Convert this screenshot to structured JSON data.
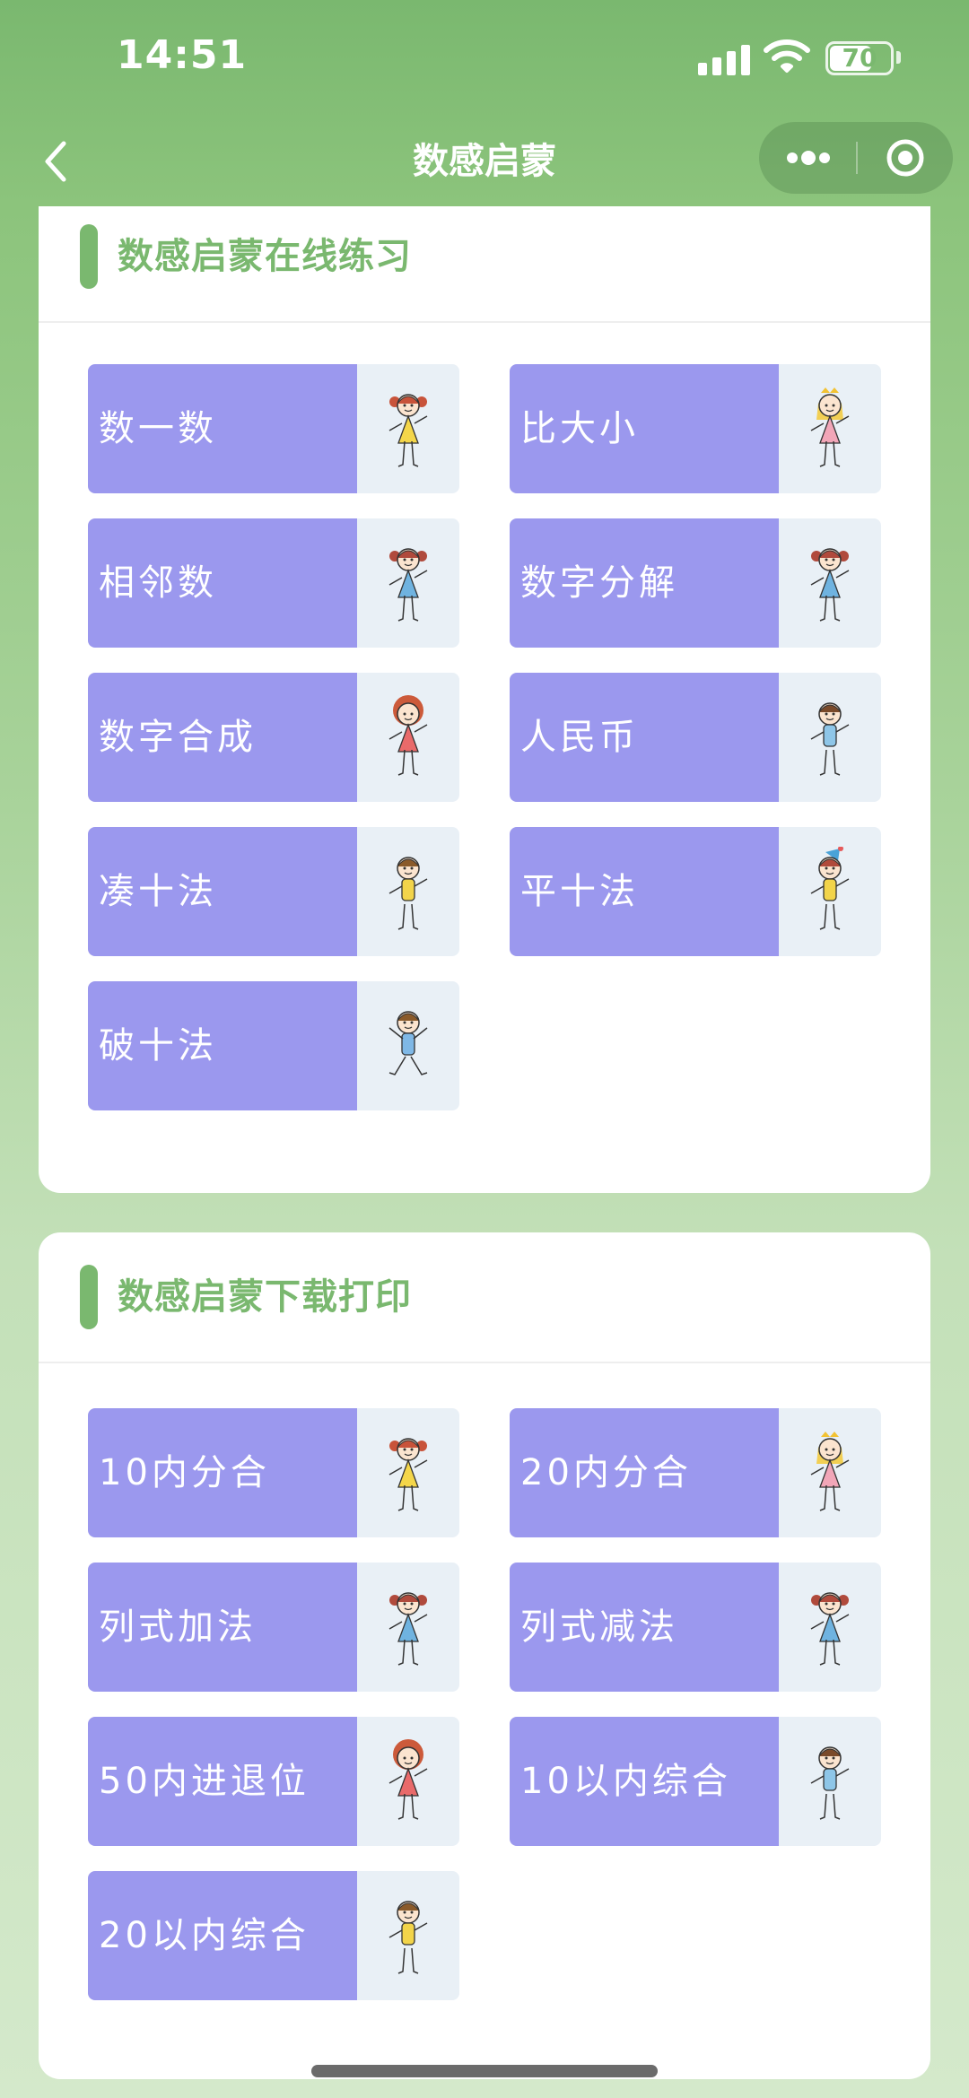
{
  "status_bar": {
    "time": "14:51",
    "battery": "70",
    "battery_level": 0.7
  },
  "nav": {
    "title": "数感启蒙"
  },
  "colors": {
    "accent_green": "#7ab86f",
    "tile_purple": "#9b98ee",
    "tile_art_bg": "#e9f0f6"
  },
  "sections": [
    {
      "title": "数感启蒙在线练习",
      "items": [
        {
          "label": "数一数",
          "icon": "girl-pigtails-yellow-dress-icon"
        },
        {
          "label": "比大小",
          "icon": "princess-pink-dress-icon"
        },
        {
          "label": "相邻数",
          "icon": "girl-blue-dress-icon"
        },
        {
          "label": "数字分解",
          "icon": "girl-blue-dress-icon"
        },
        {
          "label": "数字合成",
          "icon": "girl-red-dress-icon"
        },
        {
          "label": "人民币",
          "icon": "boy-blue-shirt-icon"
        },
        {
          "label": "凑十法",
          "icon": "boy-yellow-shirt-waving-icon"
        },
        {
          "label": "平十法",
          "icon": "girl-party-hat-icon"
        },
        {
          "label": "破十法",
          "icon": "boy-blue-shirt-jumping-icon"
        }
      ]
    },
    {
      "title": "数感启蒙下载打印",
      "items": [
        {
          "label": "10内分合",
          "icon": "girl-pigtails-yellow-dress-icon"
        },
        {
          "label": "20内分合",
          "icon": "princess-pink-dress-icon"
        },
        {
          "label": "列式加法",
          "icon": "girl-blue-dress-icon"
        },
        {
          "label": "列式减法",
          "icon": "girl-blue-dress-icon"
        },
        {
          "label": "50内进退位",
          "icon": "girl-red-dress-icon"
        },
        {
          "label": "10以内综合",
          "icon": "boy-blue-shirt-icon"
        },
        {
          "label": "20以内综合",
          "icon": "boy-yellow-shirt-waving-icon"
        }
      ]
    }
  ]
}
